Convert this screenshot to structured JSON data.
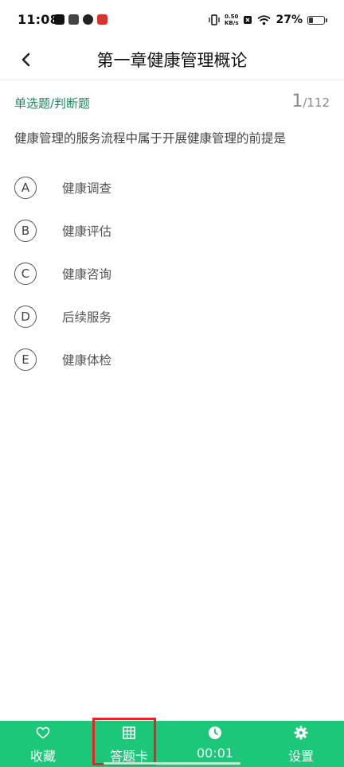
{
  "status_bar": {
    "time": "11:08",
    "net_speed_value": "0.50",
    "net_speed_unit": "KB/s",
    "battery": "27%",
    "battery_level": 0.27
  },
  "header": {
    "title": "第一章健康管理概论",
    "back_icon": "chevron-left-icon"
  },
  "question": {
    "type": "单选题/判断题",
    "current": "1",
    "total": "/112",
    "text": "健康管理的服务流程中属于开展健康管理的前提是",
    "options": [
      {
        "letter": "A",
        "text": "健康调查"
      },
      {
        "letter": "B",
        "text": "健康评估"
      },
      {
        "letter": "C",
        "text": "健康咨询"
      },
      {
        "letter": "D",
        "text": "后续服务"
      },
      {
        "letter": "E",
        "text": "健康体检"
      }
    ]
  },
  "bottom_bar": {
    "background": "#1dc77a",
    "highlight_color": "#e8222a",
    "tabs": [
      {
        "label": "收藏",
        "icon": "heart-icon"
      },
      {
        "label": "答题卡",
        "icon": "grid-icon"
      },
      {
        "label": "00:01",
        "icon": "clock-icon"
      },
      {
        "label": "设置",
        "icon": "gear-icon"
      }
    ]
  }
}
